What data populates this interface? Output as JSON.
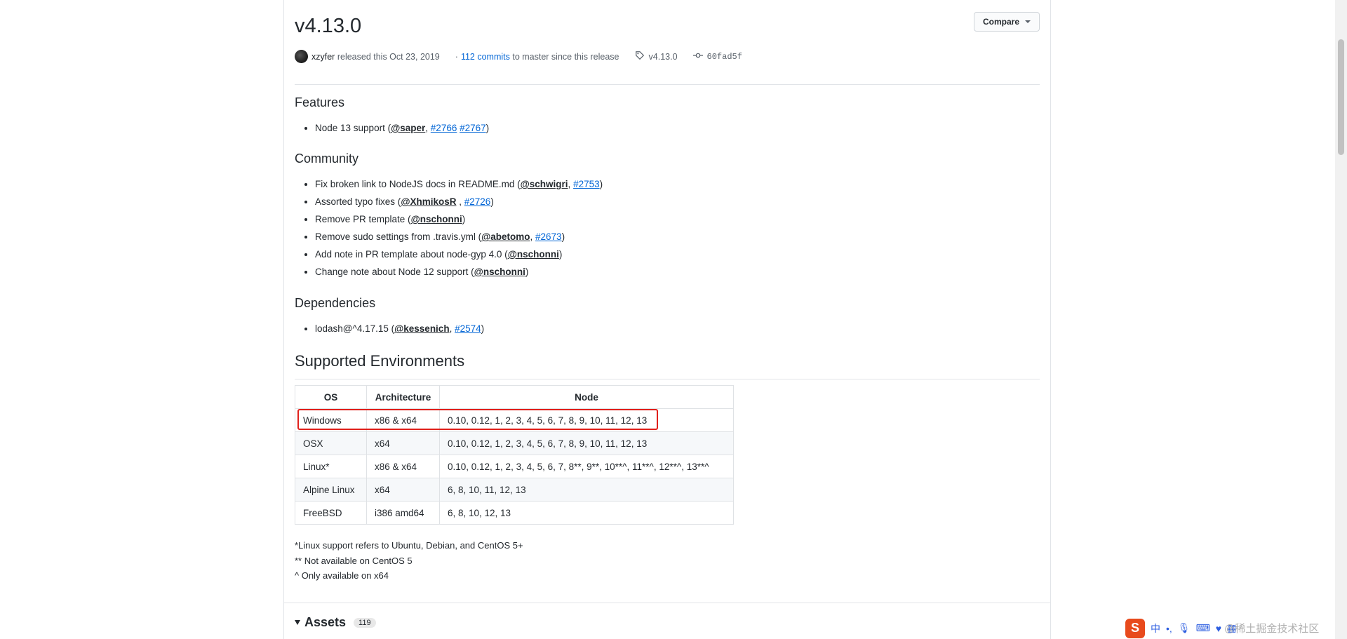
{
  "release": {
    "title": "v4.13.0",
    "compare_label": "Compare",
    "author": "xzyfer",
    "released_text": "released this Oct 23, 2019",
    "commits_prefix": "·",
    "commits_link": "112 commits",
    "commits_suffix": "to master since this release",
    "tag": "v4.13.0",
    "commit_sha": "60fad5f"
  },
  "sections": {
    "features": {
      "heading": "Features",
      "items": [
        {
          "text": "Node 13 support (",
          "mention": "@saper",
          "sep": ", ",
          "issues": [
            "#2766",
            "#2767"
          ],
          "close": ")"
        }
      ]
    },
    "community": {
      "heading": "Community",
      "items": [
        {
          "text": "Fix broken link to NodeJS docs in README.md (",
          "mention": "@schwigri",
          "sep": ", ",
          "issue": "#2753",
          "close": ")"
        },
        {
          "text": "Assorted typo fixes (",
          "mention": "@XhmikosR",
          "sep": " , ",
          "issue": "#2726",
          "close": ")"
        },
        {
          "text": "Remove PR template (",
          "mention": "@nschonni",
          "close": ")"
        },
        {
          "text": "Remove sudo settings from .travis.yml (",
          "mention": "@abetomo",
          "sep": ", ",
          "issue": "#2673",
          "close": ")"
        },
        {
          "text": "Add note in PR template about node-gyp 4.0 (",
          "mention": "@nschonni",
          "close": ")"
        },
        {
          "text": "Change note about Node 12 support (",
          "mention": "@nschonni",
          "close": ")"
        }
      ]
    },
    "dependencies": {
      "heading": "Dependencies",
      "items": [
        {
          "text": "lodash@^4.17.15 (",
          "mention": "@kessenich",
          "sep": ", ",
          "issue": "#2574",
          "close": ")"
        }
      ]
    }
  },
  "environments": {
    "heading": "Supported Environments",
    "columns": [
      "OS",
      "Architecture",
      "Node"
    ],
    "rows": [
      [
        "Windows",
        "x86 & x64",
        "0.10, 0.12, 1, 2, 3, 4, 5, 6, 7, 8, 9, 10, 11, 12, 13"
      ],
      [
        "OSX",
        "x64",
        "0.10, 0.12, 1, 2, 3, 4, 5, 6, 7, 8, 9, 10, 11, 12, 13"
      ],
      [
        "Linux*",
        "x86 & x64",
        "0.10, 0.12, 1, 2, 3, 4, 5, 6, 7, 8**, 9**, 10**^, 11**^, 12**^, 13**^"
      ],
      [
        "Alpine Linux",
        "x64",
        "6, 8, 10, 11, 12, 13"
      ],
      [
        "FreeBSD",
        "i386 amd64",
        "6, 8, 10, 12, 13"
      ]
    ],
    "notes": [
      "*Linux support refers to Ubuntu, Debian, and CentOS 5+",
      "** Not available on CentOS 5",
      "^ Only available on x64"
    ]
  },
  "assets": {
    "label": "Assets",
    "count": "119"
  },
  "taskbar": {
    "ime_logo": "S",
    "ime_lang": "中",
    "watermark": "@稀土掘金技术社区"
  },
  "colors": {
    "link": "#0366d6",
    "highlight_box": "#e0201b",
    "text": "#24292e"
  }
}
